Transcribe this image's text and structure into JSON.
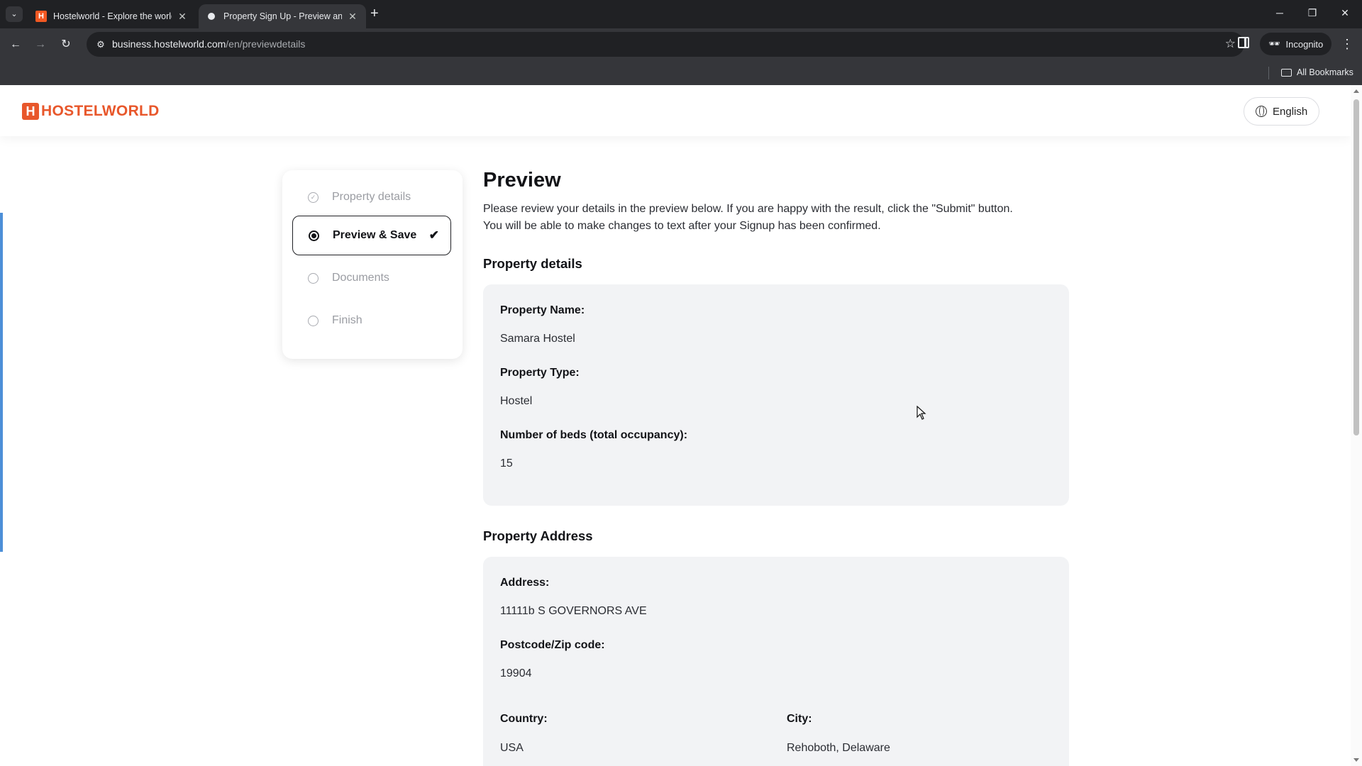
{
  "browser": {
    "tabs": [
      {
        "title": "Hostelworld - Explore the world",
        "favicon": "hostelworld-favicon",
        "active": false
      },
      {
        "title": "Property Sign Up - Preview and Save",
        "favicon": "loading-dot",
        "active": true
      }
    ],
    "url_host": "business.hostelworld.com",
    "url_path": "/en/previewdetails",
    "incognito_label": "Incognito",
    "bookmarks_label": "All Bookmarks"
  },
  "header": {
    "logo_mark": "H",
    "logo_text": "HOSTELWORLD",
    "language": "English"
  },
  "stepper": {
    "steps": [
      {
        "label": "Property details",
        "state": "done"
      },
      {
        "label": "Preview & Save",
        "state": "active"
      },
      {
        "label": "Documents",
        "state": "pending"
      },
      {
        "label": "Finish",
        "state": "pending"
      }
    ]
  },
  "main": {
    "title": "Preview",
    "intro_line1": "Please review your details in the preview below. If you are happy with the result, click the \"Submit\" button.",
    "intro_line2": "You will be able to make changes to text after your Signup has been confirmed.",
    "property_details": {
      "heading": "Property details",
      "name_label": "Property Name:",
      "name_value": "Samara Hostel",
      "type_label": "Property Type:",
      "type_value": "Hostel",
      "beds_label": "Number of beds (total occupancy):",
      "beds_value": "15"
    },
    "property_address": {
      "heading": "Property Address",
      "address_label": "Address:",
      "address_value": "11111b S GOVERNORS AVE",
      "postcode_label": "Postcode/Zip code:",
      "postcode_value": "19904",
      "country_label": "Country:",
      "country_value": "USA",
      "city_label": "City:",
      "city_value": "Rehoboth, Delaware"
    }
  },
  "colors": {
    "brand": "#e8572b",
    "panel_bg": "#f2f3f5",
    "text": "#121317",
    "muted": "#9a9ca2",
    "accent_bar": "#4d8fd8"
  }
}
